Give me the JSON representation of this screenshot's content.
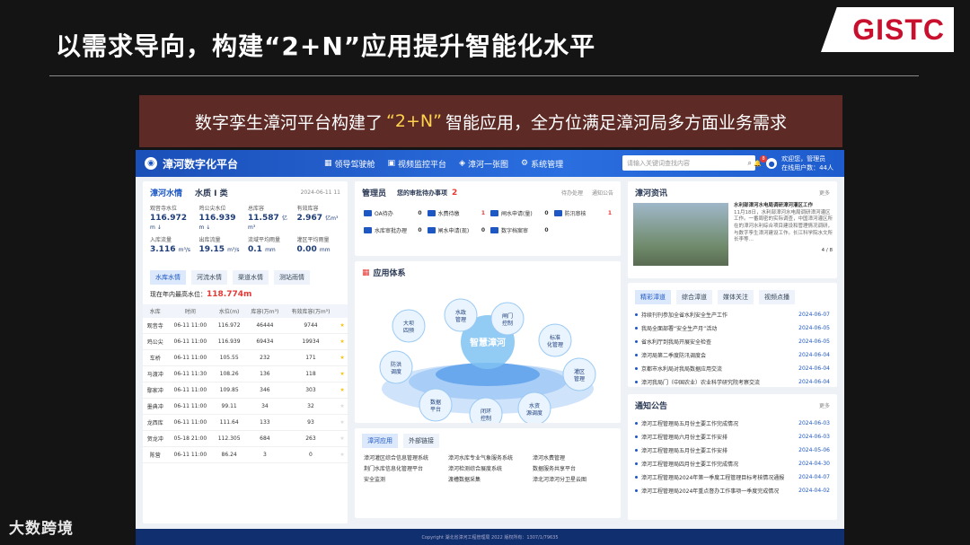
{
  "slide": {
    "title": "以需求导向，构建“2+N”应用提升智能化水平",
    "logo": "GISTC",
    "banner_pre": "数字孪生漳河平台构建了",
    "banner_hl": "“2+N”",
    "banner_post": "智能应用，全方位满足漳河局多方面业务需求",
    "watermark": "大数跨境"
  },
  "colors": {
    "banner_bg": "#5d2a26",
    "accent": "#1d57c4",
    "topbar": "#2a6ee0",
    "highlight": "#ffd34d",
    "red": "#e53935"
  },
  "app": {
    "brand": "漳河数字化平台",
    "nav": [
      {
        "label": "领导驾驶舱",
        "icon": "dashboard-icon"
      },
      {
        "label": "视频监控平台",
        "icon": "video-icon"
      },
      {
        "label": "漳河一张图",
        "icon": "map-icon"
      },
      {
        "label": "系统管理",
        "icon": "gear-icon"
      }
    ],
    "search_placeholder": "请输入关键词查找内容",
    "user": {
      "greeting": "欢迎您，管理员",
      "line2": "在线用户数：",
      "count": "44人"
    },
    "notify_count": "8",
    "water": {
      "title": "漳河水情",
      "quality": "水质 I 类",
      "date": "2024-06-11 11",
      "cells": [
        {
          "label": "观音寺水位",
          "value": "116.972",
          "unit": "m",
          "dir": "↓"
        },
        {
          "label": "鸡公尖水位",
          "value": "116.939",
          "unit": "m",
          "dir": "↓"
        },
        {
          "label": "总库容",
          "value": "11.587",
          "unit": "亿m³"
        },
        {
          "label": "有效库容",
          "value": "2.967",
          "unit": "亿m³"
        },
        {
          "label": "入库流量",
          "value": "3.116",
          "unit": "m³/s"
        },
        {
          "label": "出库流量",
          "value": "19.15",
          "unit": "m³/s"
        },
        {
          "label": "流域平均雨量",
          "value": "0.1",
          "unit": "mm"
        },
        {
          "label": "灌区平均雨量",
          "value": "0.00",
          "unit": "mm"
        }
      ],
      "tabs": [
        "水库水情",
        "河流水情",
        "渠道水情",
        "测站雨情"
      ],
      "max_label": "现在年内最高水位：",
      "max_value": "118.774m",
      "columns": [
        "水库",
        "时间",
        "水位(m)",
        "库容(万m³)",
        "有效库容(万m³)"
      ],
      "rows": [
        [
          "观音寺",
          "06-11 11:00",
          "116.972",
          "46444",
          "9744",
          "on"
        ],
        [
          "鸡公尖",
          "06-11 11:00",
          "116.939",
          "69434",
          "19934",
          "on"
        ],
        [
          "车桥",
          "06-11 11:00",
          "105.55",
          "232",
          "171",
          "on"
        ],
        [
          "马渡冲",
          "06-11 11:30",
          "108.26",
          "136",
          "118",
          "on"
        ],
        [
          "鄢家冲",
          "06-11 11:00",
          "109.85",
          "346",
          "303",
          "on"
        ],
        [
          "墨典冲",
          "06-11 11:00",
          "99.11",
          "34",
          "32",
          "off"
        ],
        [
          "龙西库",
          "06-11 11:00",
          "111.64",
          "133",
          "93",
          "off"
        ],
        [
          "贺龙冲",
          "05-18 21:00",
          "112.305",
          "684",
          "263",
          "off"
        ],
        [
          "陈营",
          "06-11 11:00",
          "86.24",
          "3",
          "0",
          "off"
        ]
      ]
    },
    "todo": {
      "role": "管理员",
      "label": "您的审批待办事项",
      "count": "2",
      "link1": "待办处理",
      "link2": "通知公告",
      "items": [
        {
          "label": "OA待办",
          "n": "0"
        },
        {
          "label": "水费待缴",
          "n": "1",
          "red": true
        },
        {
          "label": "闸水申请(量)",
          "n": "0"
        },
        {
          "label": "防汛审核",
          "n": "1",
          "red": true
        },
        {
          "label": "水库审批办理",
          "n": "0"
        },
        {
          "label": "闸水申请(现)",
          "n": "0"
        },
        {
          "label": "数字档案审",
          "n": "0"
        }
      ]
    },
    "apps": {
      "title": "应用体系",
      "center": "智慧漳河",
      "nodes": [
        "大坝四预",
        "水政管理",
        "闸门控制",
        "标准化管理",
        "灌区管理",
        "水资源调度",
        "闭环控制",
        "数据平台",
        "防洪调度"
      ],
      "tabs": [
        "漳河应用",
        "外部链接"
      ],
      "links": [
        "漳河灌区综合信息管理系统",
        "漳河水库专业气象服务系统",
        "漳河水费管理",
        "荆门水库信息化管理平台",
        "漳河检测综合展度系统",
        "数据服务共享平台",
        "安全监测",
        "渡槽数据采集",
        "漳北河漳河分卫星云图"
      ]
    },
    "news": {
      "title": "漳河资讯",
      "more": "更多",
      "headline": "水利部漳河水电局调研漳河灌区工作",
      "body": "11月18日，水利部漳河水电局调研漳河灌区工作。一番周密的实际调查，中国漳河灌区所在的漳河水利综合项目建设和管理情况调研，与数字孪生漳河建设工作。长江科学院水文所长李等…",
      "pager": "4 / 8",
      "tabs": [
        "精彩漳道",
        "综合漳道",
        "媒体关注",
        "视频点播"
      ],
      "items": [
        {
          "t": "持续刊刊参加全省水利安全生产工作",
          "d": "2024-06-07"
        },
        {
          "t": "我局全面部署“安全生产月”活动",
          "d": "2024-06-05"
        },
        {
          "t": "省水利厅到我局开展安全检查",
          "d": "2024-06-05"
        },
        {
          "t": "漳河局第二季度防汛调度会",
          "d": "2024-06-04"
        },
        {
          "t": "京都市水利局对我局数据应用交流",
          "d": "2024-06-04"
        },
        {
          "t": "漳河我局门（中国农业）农业科学研究院考察交流",
          "d": "2024-06-04"
        }
      ]
    },
    "notice": {
      "title": "通知公告",
      "more": "更多",
      "items": [
        {
          "t": "漳河工程管理局五月份主要工作完成情况",
          "d": "2024-06-03"
        },
        {
          "t": "漳河工程管理局六月份主要工作安排",
          "d": "2024-06-03"
        },
        {
          "t": "漳河工程管理局五月份主要工作安排",
          "d": "2024-05-06"
        },
        {
          "t": "漳河工程管理局四月份主要工作完成情况",
          "d": "2024-04-30"
        },
        {
          "t": "漳河工程管理局2024年第一季度工程管理目标考核情况通报",
          "d": "2024-04-07"
        },
        {
          "t": "漳河工程管理局2024年重点督办工作事项一季度完成情况",
          "d": "2024-04-02"
        }
      ]
    },
    "footer": "Copyright 湖北省漳河工程管理局 2022 版权所有：1307/1/79635"
  }
}
